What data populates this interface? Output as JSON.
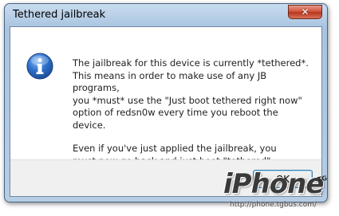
{
  "window": {
    "title": "Tethered jailbreak",
    "close_icon": "close-icon",
    "close_glyph": "✕"
  },
  "dialog": {
    "icon": "info-icon",
    "message_paragraph_1": "The jailbreak for this device is currently *tethered*.\nThis means in order to make use of any JB programs,\nyou *must* use the \"Just boot tethered right now\"\noption of redsn0w every time you reboot the device.",
    "message_paragraph_2": "Even if you've just applied the jailbreak, you\nmust now go back and just boot \"tethered\"."
  },
  "buttons": {
    "ok_label": "OK"
  },
  "watermark": {
    "logo_text": "iPhone",
    "badge_text": "TG",
    "url_text": "http://phone.tgbus.com/"
  },
  "colors": {
    "window_frame": "#b6cde5",
    "close_button": "#c8432b",
    "info_icon_blue": "#2a63b8",
    "ok_button_border": "#3c7fb1"
  }
}
